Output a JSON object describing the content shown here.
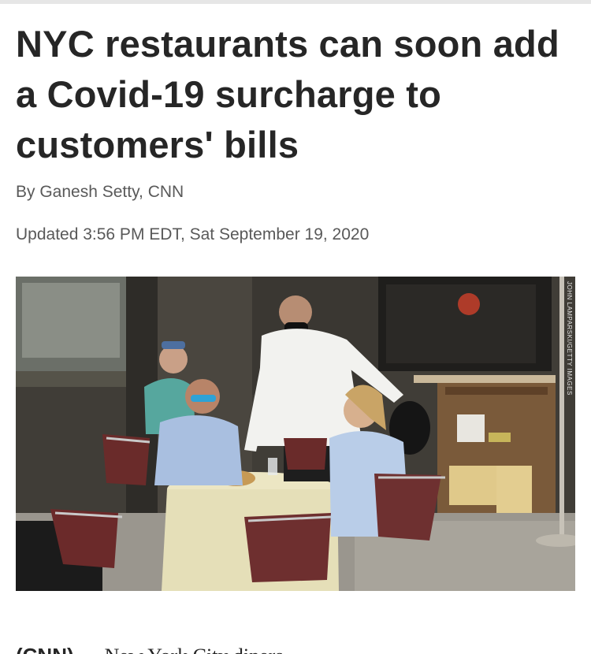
{
  "article": {
    "headline": "NYC restaurants can soon add a Covid-19 surcharge to customers' bills",
    "byline": "By Ganesh Setty, CNN",
    "updated": "Updated 3:56 PM EDT, Sat September 19, 2020"
  },
  "photo": {
    "credit": "JOHN LAMPARSKI/GETTY IMAGES"
  },
  "body": {
    "dateline": "(CNN)",
    "text_start": "New York City diners"
  },
  "colors": {
    "headline": "#262626",
    "meta": "#595959",
    "background": "#ffffff"
  }
}
